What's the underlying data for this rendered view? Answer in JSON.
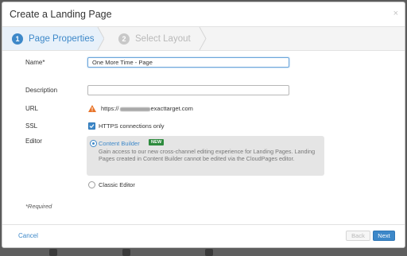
{
  "dialog": {
    "title": "Create a Landing Page",
    "close_glyph": "×"
  },
  "steps": [
    {
      "number": "1",
      "label": "Page Properties",
      "active": true
    },
    {
      "number": "2",
      "label": "Select Layout",
      "active": false
    }
  ],
  "form": {
    "name": {
      "label": "Name*",
      "value": "One More Time - Page"
    },
    "description": {
      "label": "Description",
      "value": ""
    },
    "url": {
      "label": "URL",
      "prefix": "https://",
      "suffix": "exacttarget.com",
      "icon": "warning-icon"
    },
    "ssl": {
      "label": "SSL",
      "checkbox_label": "HTTPS connections only",
      "checked": true
    },
    "editor": {
      "label": "Editor",
      "options": [
        {
          "title": "Content Builder",
          "badge": "NEW",
          "description": "Gain access to our new cross-channel editing experience for Landing Pages. Landing Pages created in Content Builder cannot be edited via the CloudPages editor.",
          "selected": true
        },
        {
          "title": "Classic Editor",
          "selected": false
        }
      ]
    },
    "required_note": "*Required"
  },
  "footer": {
    "cancel_label": "Cancel",
    "back_label": "Back",
    "next_label": "Next"
  },
  "colors": {
    "accent": "#3d88c9",
    "badge_green": "#2e8b3e",
    "warning": "#e8742a"
  }
}
